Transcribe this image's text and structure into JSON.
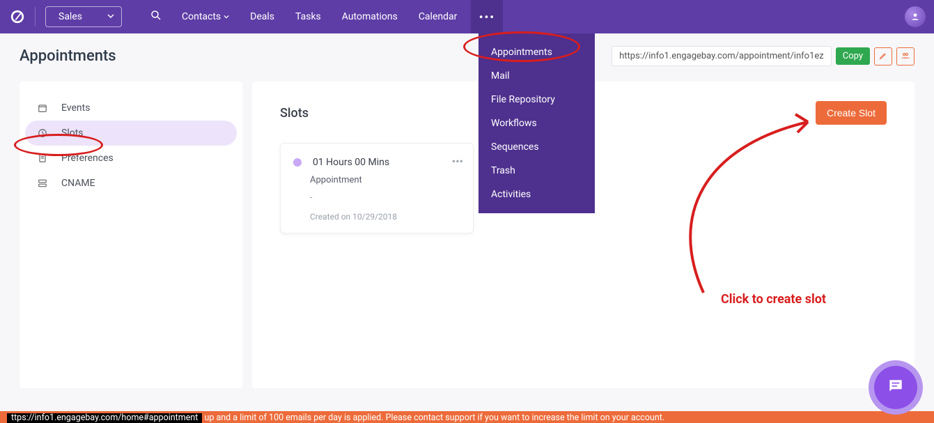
{
  "header": {
    "module": "Sales",
    "nav": [
      "Contacts",
      "Deals",
      "Tasks",
      "Automations",
      "Calendar"
    ]
  },
  "dropdown": [
    "Appointments",
    "Mail",
    "File Repository",
    "Workflows",
    "Sequences",
    "Trash",
    "Activities"
  ],
  "page": {
    "title": "Appointments",
    "url": "https://info1.engagebay.com/appointment/info1ez",
    "copy": "Copy"
  },
  "sidebar": {
    "items": [
      {
        "label": "Events"
      },
      {
        "label": "Slots"
      },
      {
        "label": "Preferences"
      },
      {
        "label": "CNAME"
      }
    ]
  },
  "main": {
    "title": "Slots",
    "create": "Create Slot",
    "card": {
      "title": "01 Hours 00 Mins",
      "sub": "Appointment",
      "dash": "-",
      "date": "Created on 10/29/2018"
    }
  },
  "annotation": "Click to create slot",
  "footer": {
    "left": "ttps://info1.engagebay.com/home#appointment",
    "right": "up and a limit of 100 emails per day is applied. Please contact support if you want to increase the limit on your account."
  }
}
